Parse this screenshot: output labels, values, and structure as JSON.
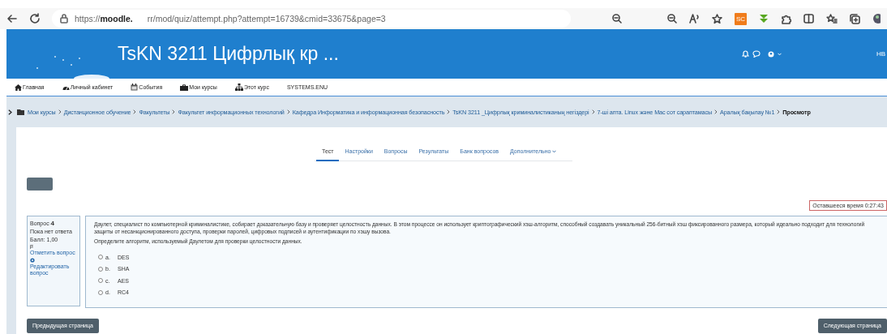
{
  "browser": {
    "url_start": "https://",
    "url_host": "moodle.",
    "url_path": "rr/mod/quiz/attempt.php?attempt=16739&cmid=33675&page=3",
    "extension_badge": "SC"
  },
  "header": {
    "title": "TsKN 3211 Цифрлық кр ...",
    "user_initials": "НВ"
  },
  "nav": [
    {
      "label": "Главная",
      "kind": "home"
    },
    {
      "label": "Личный кабинет",
      "kind": "dashboard"
    },
    {
      "label": "События",
      "kind": "calendar"
    },
    {
      "label": "Мои курсы",
      "kind": "courses"
    },
    {
      "label": "Этот курс",
      "kind": "course"
    },
    {
      "label": "SYSTEMS.ENU",
      "kind": "plain"
    }
  ],
  "breadcrumb": [
    {
      "label": "Мои курсы",
      "current": false
    },
    {
      "label": "Дистанционное обучение",
      "current": false
    },
    {
      "label": "Факультеты",
      "current": false
    },
    {
      "label": "Факультет информационных технологий",
      "current": false
    },
    {
      "label": "Кафедра Информатика и информационная безопасность",
      "current": false
    },
    {
      "label": "TsKN 3211 _Цифрлық криминалистиканың негіздері",
      "current": false
    },
    {
      "label": "7-ші апта. Linux және Mac сот сараптамасы",
      "current": false
    },
    {
      "label": "Аралық бақылау №1",
      "current": false
    },
    {
      "label": "Просмотр",
      "current": true
    }
  ],
  "tabs": [
    {
      "label": "Тест",
      "selected": true,
      "dropdown": false
    },
    {
      "label": "Настройки",
      "selected": false,
      "dropdown": false
    },
    {
      "label": "Вопросы",
      "selected": false,
      "dropdown": false
    },
    {
      "label": "Результаты",
      "selected": false,
      "dropdown": false
    },
    {
      "label": "Банк вопросов",
      "selected": false,
      "dropdown": false
    },
    {
      "label": "Дополнительно",
      "selected": false,
      "dropdown": true
    }
  ],
  "timer": "Оставшееся время 0:27:43",
  "question_info": {
    "number_label": "Вопрос",
    "number": "4",
    "status": "Пока нет ответа",
    "mark": "Балл: 1,00",
    "flag_link": "Отметить вопрос",
    "edit_link": "Редактировать вопрос"
  },
  "question": {
    "text": "Даулет, специалист по компьютерной криминалистике, собирает доказательную базу и проверяет целостность данных. В этом процессе он использует криптографический хэш-алгоритм, способный создавать уникальный 256-битный хэш фиксированного размера, который идеально подходит для технологий защиты от несанкционированного доступа, проверки паролей, цифровых подписей и аутентификации по хэшу вызова.",
    "prompt": "Определите алгоритм, используемый Даулетом для проверки целостности данных.",
    "options": [
      {
        "letter": "a.",
        "text": "DES",
        "selected": false
      },
      {
        "letter": "b.",
        "text": "SHA",
        "selected": false
      },
      {
        "letter": "c.",
        "text": "AES",
        "selected": false
      },
      {
        "letter": "d.",
        "text": "RC4",
        "selected": false
      }
    ]
  },
  "buttons": {
    "previous": "Предыдущая страница",
    "next": "Следующая страница"
  }
}
